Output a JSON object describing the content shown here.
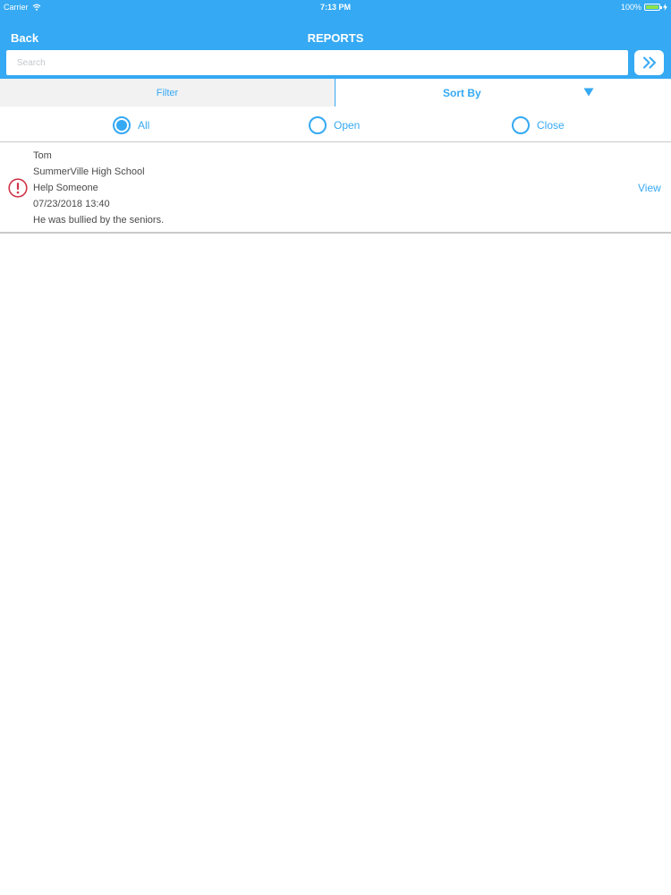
{
  "status_bar": {
    "carrier": "Carrier",
    "time": "7:13 PM",
    "battery": "100%",
    "battery_level": 1.0
  },
  "nav": {
    "back_label": "Back",
    "title": "REPORTS"
  },
  "search": {
    "placeholder": "Search",
    "value": "",
    "go_icon": "double-chevron-right-icon"
  },
  "segments": {
    "filter_label": "Filter",
    "sort_label": "Sort By",
    "sort_icon": "triangle-down-icon"
  },
  "radios": {
    "selected": "All",
    "options": [
      "All",
      "Open",
      "Close"
    ]
  },
  "reports": [
    {
      "status_icon": "alert-circle-icon",
      "name": "Tom",
      "school": "SummerVille High School",
      "category": "Help Someone",
      "datetime": "07/23/2018 13:40",
      "description": "He was bullied by the seniors.",
      "action_label": "View"
    }
  ],
  "colors": {
    "accent": "#35a9f3",
    "alert": "#d0354a",
    "text": "#4a4a4a",
    "divider": "#c9c9c9",
    "segment_bg": "#f2f2f2"
  }
}
